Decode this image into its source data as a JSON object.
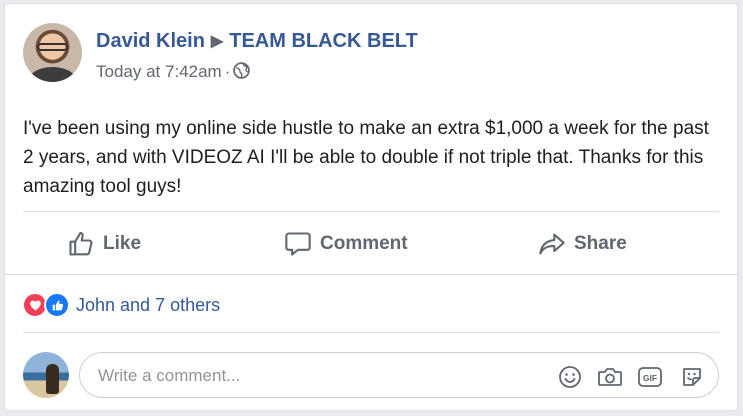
{
  "post": {
    "author": "David Klein",
    "separator": "▶",
    "group": "TEAM BLACK BELT",
    "timestamp": "Today at 7:42am",
    "meta_dot": "·",
    "privacy_icon": "globe-icon",
    "text": "I've been using my online side hustle to make an extra $1,000 a week for the past 2 years, and with VIDEOZ AI I'll be able to double if not triple that. Thanks for this amazing tool guys!"
  },
  "actions": {
    "like_label": "Like",
    "comment_label": "Comment",
    "share_label": "Share"
  },
  "reactions": {
    "icons": [
      "heart-icon",
      "thumbs-up-icon"
    ],
    "summary": "John and 7 others"
  },
  "comment_input": {
    "placeholder": "Write a comment...",
    "value": "",
    "icons": [
      "emoji-icon",
      "camera-icon",
      "gif-icon",
      "sticker-icon"
    ]
  },
  "colors": {
    "link": "#365899",
    "secondary_text": "#606770",
    "heart": "#f33e58",
    "like": "#1877f2",
    "background": "#e9ebee"
  }
}
